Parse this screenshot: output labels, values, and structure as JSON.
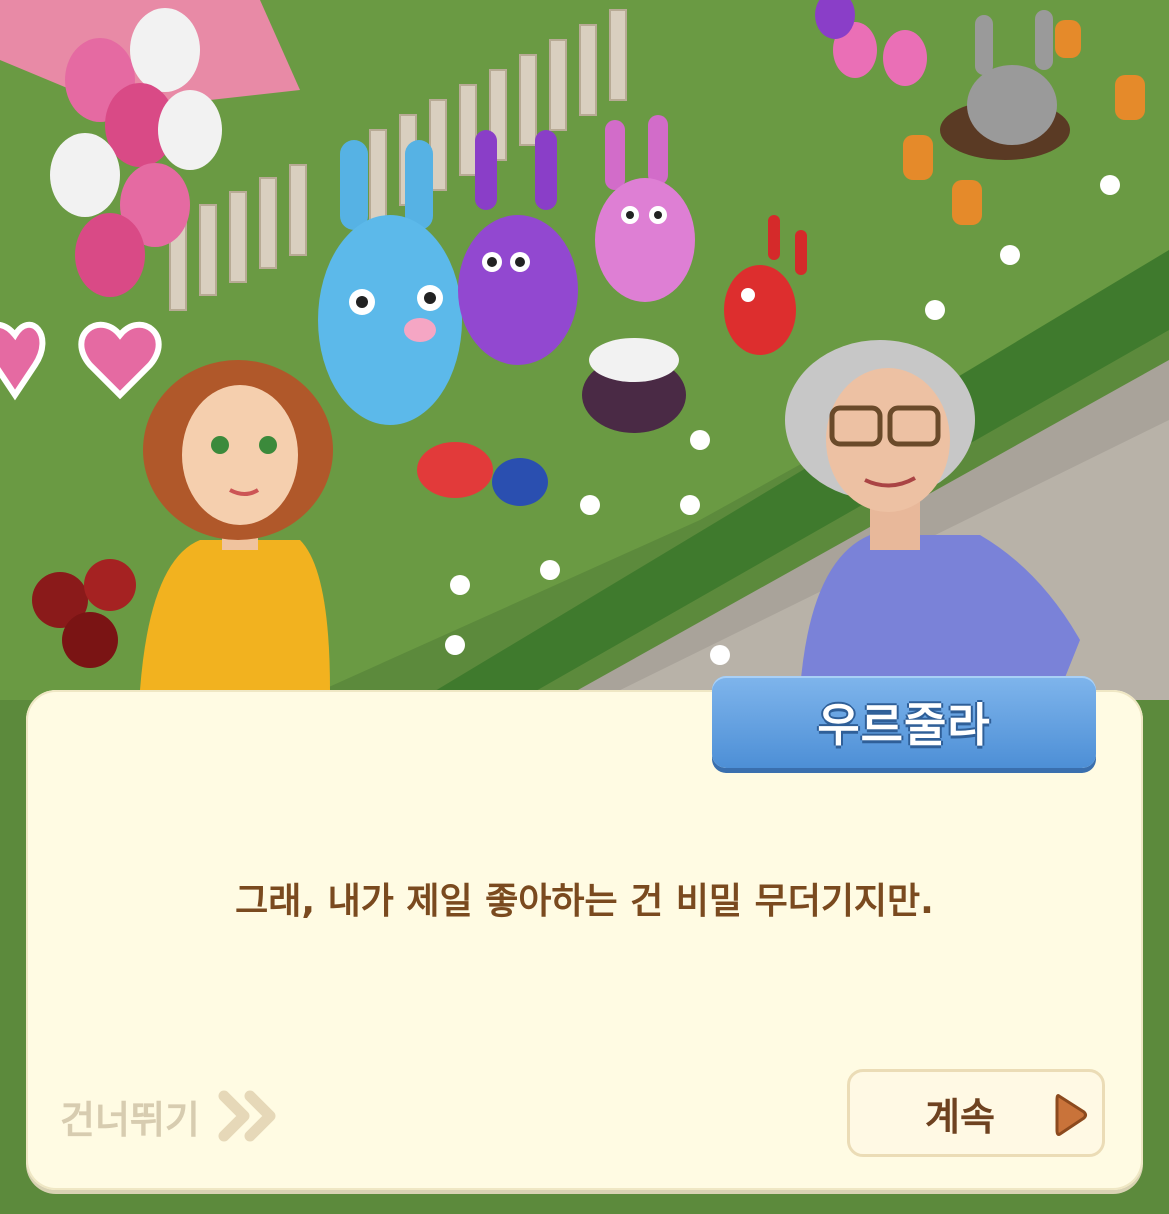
{
  "dialog": {
    "speaker_name": "우르줄라",
    "line": "그래, 내가 제일 좋아하는 건 비밀 무더기지만.",
    "skip_label": "건너뛰기",
    "continue_label": "계속"
  },
  "icons": {
    "skip": "double-chevron-right-icon",
    "continue": "play-triangle-icon"
  },
  "colors": {
    "dialog_bg": "#fffbe3",
    "name_tag": "#5f9fe0",
    "dialog_text": "#7a4a1f",
    "skip_text": "#d7ccb0",
    "continue_text": "#6e4220",
    "continue_arrow": "#c9733a"
  }
}
